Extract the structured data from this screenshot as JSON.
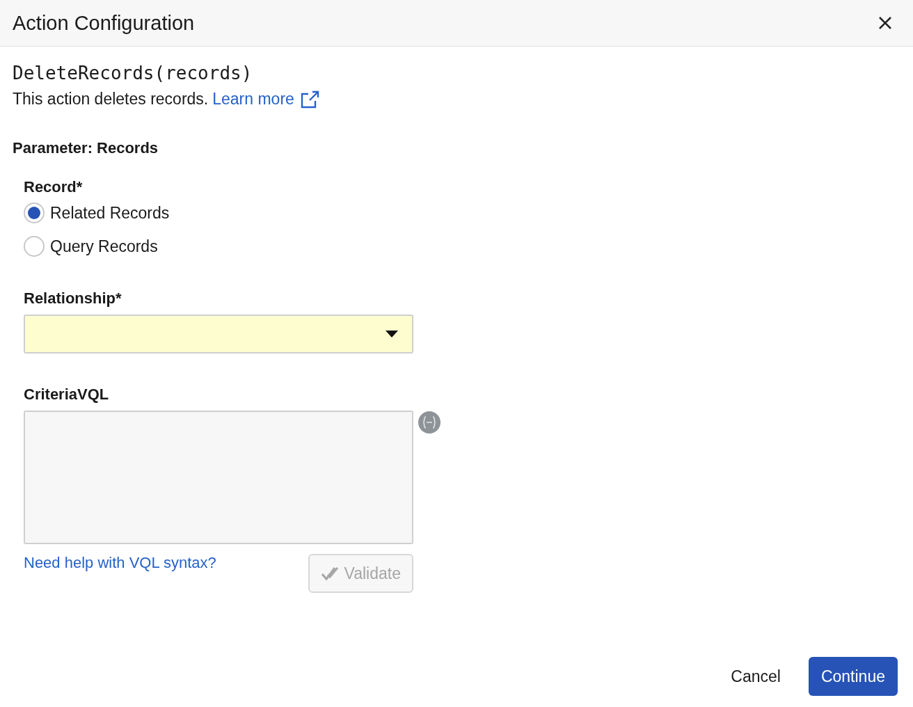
{
  "window": {
    "title": "Action Configuration"
  },
  "action": {
    "signature": "DeleteRecords(records)",
    "description": "This action deletes records.",
    "learn_more": "Learn more"
  },
  "parameter_heading": "Parameter: Records",
  "record": {
    "label": "Record*",
    "options": [
      {
        "label": "Related Records",
        "selected": true
      },
      {
        "label": "Query Records",
        "selected": false
      }
    ]
  },
  "relationship": {
    "label": "Relationship*",
    "highlighted": true
  },
  "criteria": {
    "label": "CriteriaVQL",
    "help_link": "Need help with VQL syntax?",
    "validate": {
      "label": "Validate",
      "disabled": true
    }
  },
  "buttons": {
    "cancel": "Cancel",
    "continue": "Continue"
  }
}
